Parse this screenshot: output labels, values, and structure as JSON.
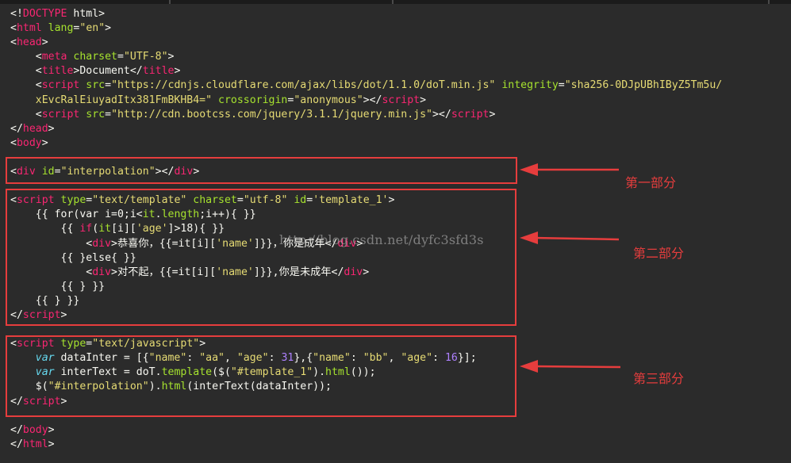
{
  "code_lines": [
    [
      [
        "p",
        "<!"
      ],
      [
        "t",
        "DOCTYPE"
      ],
      [
        "p",
        " html>"
      ]
    ],
    [
      [
        "p",
        "<"
      ],
      [
        "t",
        "html"
      ],
      [
        "a",
        " lang"
      ],
      [
        "p",
        "="
      ],
      [
        "s",
        "\"en\""
      ],
      [
        "p",
        ">"
      ]
    ],
    [
      [
        "p",
        "<"
      ],
      [
        "t",
        "head"
      ],
      [
        "p",
        ">"
      ]
    ],
    [
      [
        "p",
        "    <"
      ],
      [
        "t",
        "meta"
      ],
      [
        "a",
        " charset"
      ],
      [
        "p",
        "="
      ],
      [
        "s",
        "\"UTF-8\""
      ],
      [
        "p",
        ">"
      ]
    ],
    [
      [
        "p",
        "    <"
      ],
      [
        "t",
        "title"
      ],
      [
        "p",
        ">Document</"
      ],
      [
        "t",
        "title"
      ],
      [
        "p",
        ">"
      ]
    ],
    [
      [
        "p",
        "    <"
      ],
      [
        "t",
        "script"
      ],
      [
        "a",
        " src"
      ],
      [
        "p",
        "="
      ],
      [
        "s",
        "\"https://cdnjs.cloudflare.com/ajax/libs/dot/1.1.0/doT.min.js\""
      ],
      [
        "a",
        " integrity"
      ],
      [
        "p",
        "="
      ],
      [
        "s",
        "\"sha256-0DJpUBhIByZ5Tm5u/"
      ]
    ],
    [
      [
        "s",
        "    xEvcRalEiuyadItx381FmBKHB4=\""
      ],
      [
        "a",
        " crossorigin"
      ],
      [
        "p",
        "="
      ],
      [
        "s",
        "\"anonymous\""
      ],
      [
        "p",
        "></"
      ],
      [
        "t",
        "script"
      ],
      [
        "p",
        ">"
      ]
    ],
    [
      [
        "p",
        "    <"
      ],
      [
        "t",
        "script"
      ],
      [
        "a",
        " src"
      ],
      [
        "p",
        "="
      ],
      [
        "s",
        "\"http://cdn.bootcss.com/jquery/3.1.1/jquery.min.js\""
      ],
      [
        "p",
        "></"
      ],
      [
        "t",
        "script"
      ],
      [
        "p",
        ">"
      ]
    ],
    [
      [
        "p",
        "</"
      ],
      [
        "t",
        "head"
      ],
      [
        "p",
        ">"
      ]
    ],
    [
      [
        "p",
        "<"
      ],
      [
        "t",
        "body"
      ],
      [
        "p",
        ">"
      ]
    ],
    [],
    [
      [
        "p",
        "<"
      ],
      [
        "t",
        "div"
      ],
      [
        "a",
        " id"
      ],
      [
        "p",
        "="
      ],
      [
        "s",
        "\"interpolation\""
      ],
      [
        "p",
        "></"
      ],
      [
        "t",
        "div"
      ],
      [
        "p",
        ">"
      ]
    ],
    [],
    [
      [
        "p",
        "<"
      ],
      [
        "t",
        "script"
      ],
      [
        "a",
        " type"
      ],
      [
        "p",
        "="
      ],
      [
        "s",
        "\"text/template\""
      ],
      [
        "a",
        " charset"
      ],
      [
        "p",
        "="
      ],
      [
        "s",
        "\"utf-8\""
      ],
      [
        "a",
        " id"
      ],
      [
        "p",
        "="
      ],
      [
        "s",
        "'template_1'"
      ],
      [
        "p",
        ">"
      ]
    ],
    [
      [
        "p",
        "    {{ for(var i=0;i<"
      ],
      [
        "a",
        "it"
      ],
      [
        "p",
        "."
      ],
      [
        "a",
        "length"
      ],
      [
        "p",
        ";i++){ }}"
      ]
    ],
    [
      [
        "p",
        "        {{ "
      ],
      [
        "t",
        "if"
      ],
      [
        "p",
        "("
      ],
      [
        "a",
        "it"
      ],
      [
        "p",
        "[i]["
      ],
      [
        "s",
        "'age'"
      ],
      [
        "p",
        "]>18){ }}"
      ]
    ],
    [
      [
        "p",
        "            <"
      ],
      [
        "t",
        "div"
      ],
      [
        "p",
        ">恭喜你，{{=it[i]["
      ],
      [
        "s",
        "'name'"
      ],
      [
        "p",
        "]}}，你是成年</"
      ],
      [
        "t",
        "div"
      ],
      [
        "p",
        ">"
      ]
    ],
    [
      [
        "p",
        "        {{ }else{ }}"
      ]
    ],
    [
      [
        "p",
        "            <"
      ],
      [
        "t",
        "div"
      ],
      [
        "p",
        ">对不起，{{=it[i]["
      ],
      [
        "s",
        "'name'"
      ],
      [
        "p",
        "]}},你是未成年</"
      ],
      [
        "t",
        "div"
      ],
      [
        "p",
        ">"
      ]
    ],
    [
      [
        "p",
        "        {{ } }}"
      ]
    ],
    [
      [
        "p",
        "    {{ } }}"
      ]
    ],
    [
      [
        "p",
        "</"
      ],
      [
        "t",
        "script"
      ],
      [
        "p",
        ">"
      ]
    ],
    [],
    [
      [
        "p",
        "<"
      ],
      [
        "t",
        "script"
      ],
      [
        "a",
        " type"
      ],
      [
        "p",
        "="
      ],
      [
        "s",
        "\"text/javascript\""
      ],
      [
        "p",
        ">"
      ]
    ],
    [
      [
        "k",
        "    var"
      ],
      [
        "p",
        " dataInter = [{"
      ],
      [
        "s",
        "\"name\""
      ],
      [
        "p",
        ": "
      ],
      [
        "s",
        "\"aa\""
      ],
      [
        "p",
        ", "
      ],
      [
        "s",
        "\"age\""
      ],
      [
        "p",
        ": "
      ],
      [
        "n",
        "31"
      ],
      [
        "p",
        "},{"
      ],
      [
        "s",
        "\"name\""
      ],
      [
        "p",
        ": "
      ],
      [
        "s",
        "\"bb\""
      ],
      [
        "p",
        ", "
      ],
      [
        "s",
        "\"age\""
      ],
      [
        "p",
        ": "
      ],
      [
        "n",
        "16"
      ],
      [
        "p",
        "}];"
      ]
    ],
    [
      [
        "k",
        "    var"
      ],
      [
        "p",
        " interText = doT."
      ],
      [
        "a",
        "template"
      ],
      [
        "p",
        "($("
      ],
      [
        "s",
        "\"#template_1\""
      ],
      [
        "p",
        ")."
      ],
      [
        "a",
        "html"
      ],
      [
        "p",
        "());"
      ]
    ],
    [
      [
        "p",
        "    $("
      ],
      [
        "s",
        "\"#interpolation\""
      ],
      [
        "p",
        ")."
      ],
      [
        "a",
        "html"
      ],
      [
        "p",
        "(interText(dataInter));"
      ]
    ],
    [
      [
        "p",
        "</"
      ],
      [
        "t",
        "script"
      ],
      [
        "p",
        ">"
      ]
    ],
    [],
    [
      [
        "p",
        "</"
      ],
      [
        "t",
        "body"
      ],
      [
        "p",
        ">"
      ]
    ],
    [
      [
        "p",
        "</"
      ],
      [
        "t",
        "html"
      ],
      [
        "p",
        ">"
      ]
    ]
  ],
  "annotations": {
    "label_1": "第一部分",
    "label_2": "第二部分",
    "label_3": "第三部分",
    "watermark": "http://blog.csdn.net/dyfc3sfd3s"
  },
  "colors": {
    "background": "#2b2b2b",
    "tag": "#f92672",
    "attribute": "#a6e22e",
    "string": "#e6db74",
    "number": "#ae81ff",
    "keyword": "#66d9ef",
    "annotation_red": "#e63d3d"
  }
}
